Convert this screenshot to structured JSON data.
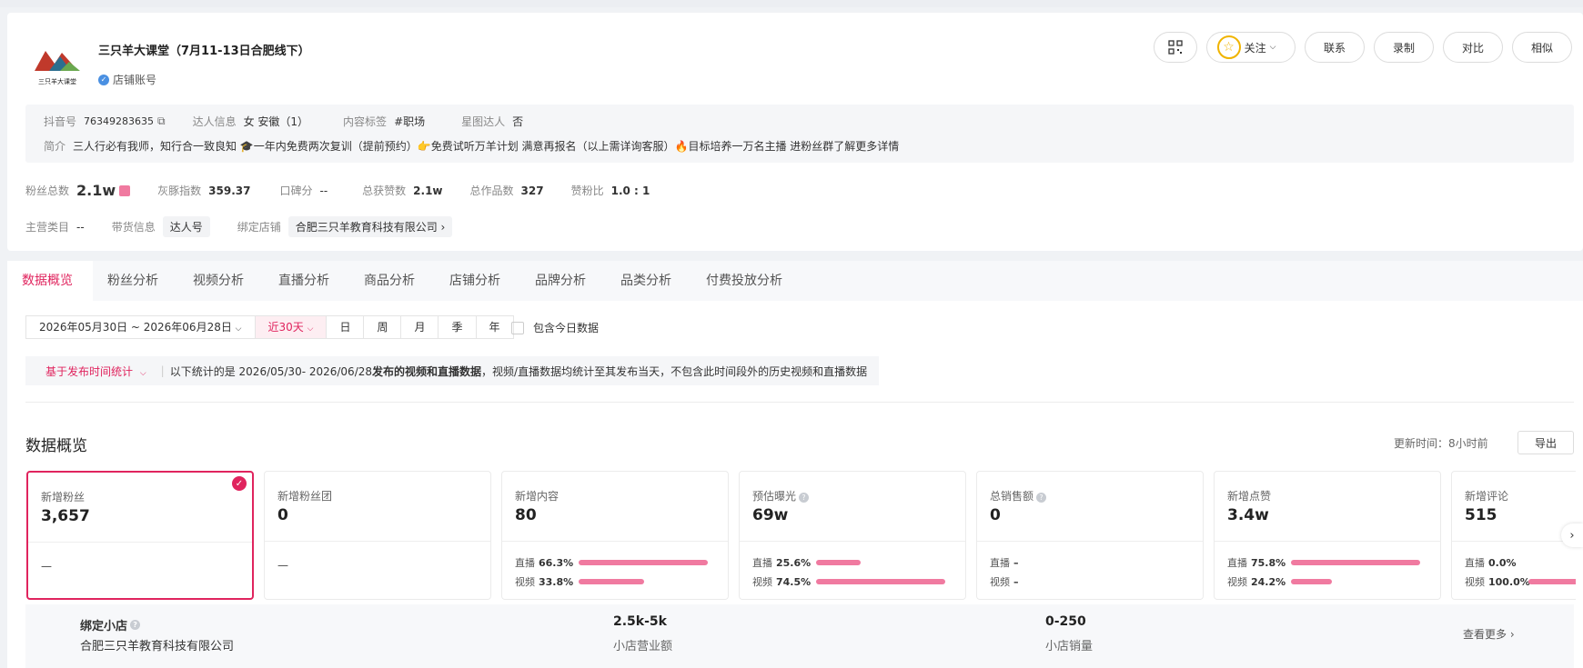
{
  "profile": {
    "title": "三只羊大课堂（7月11-13日合肥线下）",
    "account_type": "店铺账号",
    "actions": [
      "关注",
      "联系",
      "录制",
      "对比",
      "相似"
    ],
    "douyin_label": "抖音号",
    "douyin_id": "76349283635",
    "talent_label": "达人信息",
    "talent_value": "女 安徽（1）",
    "content_tag_label": "内容标签",
    "content_tag": "#职场",
    "star_label": "星图达人",
    "star_value": "否",
    "intro_label": "简介",
    "intro": "三人行必有我师，知行合一致良知 🎓一年内免费两次复训（提前预约）👉免费试听万羊计划 满意再报名（以上需详询客服）🔥目标培养一万名主播 进粉丝群了解更多详情"
  },
  "stats": {
    "fans_label": "粉丝总数",
    "fans_value": "2.1w",
    "grey_label": "灰豚指数",
    "grey_value": "359.37",
    "rep_label": "口碑分",
    "rep_value": "--",
    "likes_label": "总获赞数",
    "likes_value": "2.1w",
    "works_label": "总作品数",
    "works_value": "327",
    "ratio_label": "赞粉比",
    "ratio_value": "1.0 : 1",
    "category_label": "主营类目",
    "category_value": "--",
    "goods_label": "带货信息",
    "goods_value": "达人号",
    "shop_label": "绑定店铺",
    "shop_value": "合肥三只羊教育科技有限公司 ›"
  },
  "tabs": [
    "数据概览",
    "粉丝分析",
    "视频分析",
    "直播分析",
    "商品分析",
    "店铺分析",
    "品牌分析",
    "品类分析",
    "付费投放分析"
  ],
  "filter": {
    "date_range": "2026年05月30日 ~ 2026年06月28日",
    "presets": [
      "近30天",
      "日",
      "周",
      "月",
      "季",
      "年"
    ],
    "include_today": "包含今日数据"
  },
  "notice": {
    "mode": "基于发布时间统计",
    "prefix": "以下统计的是 2026/05/30- 2026/06/28 ",
    "bold": "发布的视频和直播数据",
    "suffix": "，视频/直播数据均统计至其发布当天，不包含此时间段外的历史视频和直播数据"
  },
  "overview": {
    "title": "数据概览",
    "updated": "更新时间：8小时前",
    "export": "导出"
  },
  "metrics": [
    {
      "label": "新增粉丝",
      "value": "3,657",
      "dash": "—"
    },
    {
      "label": "新增粉丝团",
      "value": "0",
      "dash": "—"
    },
    {
      "label": "新增内容",
      "value": "80",
      "live": "66.3%",
      "video": "33.8%"
    },
    {
      "label": "预估曝光",
      "value": "69w",
      "live": "25.6%",
      "video": "74.5%"
    },
    {
      "label": "总销售额",
      "value": "0",
      "live": "–",
      "video": "–"
    },
    {
      "label": "新增点赞",
      "value": "3.4w",
      "live": "75.8%",
      "video": "24.2%"
    },
    {
      "label": "新增评论",
      "value": "515",
      "live": "0.0%",
      "video": "100.0%"
    }
  ],
  "bar_labels": {
    "live": "直播",
    "video": "视频"
  },
  "shop": {
    "label": "绑定小店",
    "name": "合肥三只羊教育科技有限公司",
    "revenue": "2.5k-5k",
    "revenue_label": "小店营业额",
    "sales": "0-250",
    "sales_label": "小店销量",
    "more": "查看更多 ›"
  }
}
